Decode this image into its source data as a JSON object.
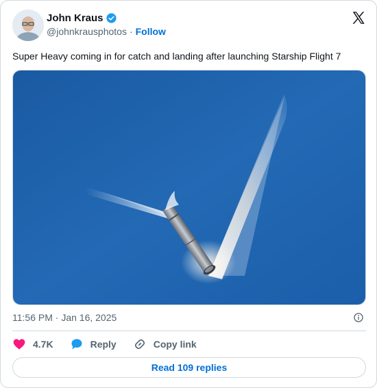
{
  "author": {
    "name": "John Kraus",
    "handle": "@johnkrausphotos",
    "separator": "·",
    "follow_label": "Follow"
  },
  "tweet": {
    "text": "Super Heavy coming in for catch and landing after launching Starship Flight 7",
    "timestamp": "11:56 PM · Jan 16, 2025"
  },
  "actions": {
    "likes": "4.7K",
    "reply_label": "Reply",
    "copy_link_label": "Copy link"
  },
  "replies_button": "Read 109 replies",
  "icons": {
    "verified": "verified-badge-icon",
    "x_logo": "x-logo-icon",
    "info": "info-icon",
    "heart": "heart-icon",
    "reply": "reply-bubble-icon",
    "link": "link-icon"
  },
  "colors": {
    "link_blue": "#006fd6",
    "heart_red": "#f91880",
    "reply_blue": "#1d9bf0",
    "muted": "#536471",
    "border": "#cfd9de",
    "sky": "#1f5fa8"
  }
}
